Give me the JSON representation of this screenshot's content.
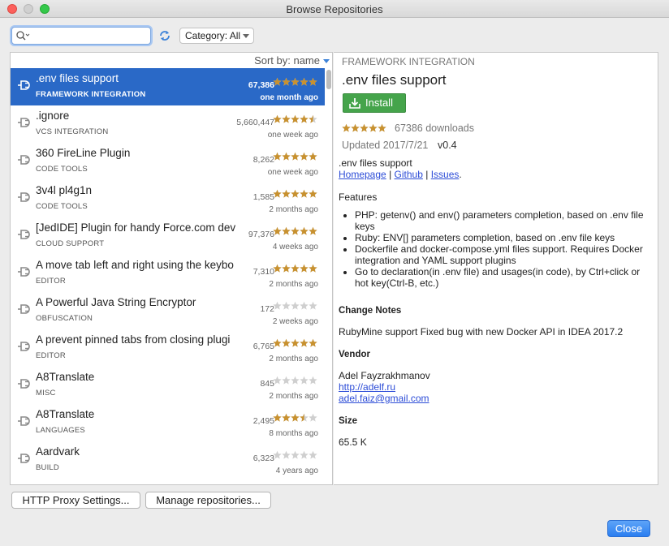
{
  "window": {
    "title": "Browse Repositories"
  },
  "toolbar": {
    "search_value": "",
    "category_label": "Category: All"
  },
  "list": {
    "sort_label": "Sort by: name",
    "items": [
      {
        "name": ".env files support",
        "category": "FRAMEWORK INTEGRATION",
        "downloads": "67,386",
        "rating": 5,
        "date": "one month ago",
        "selected": true
      },
      {
        "name": ".ignore",
        "category": "VCS INTEGRATION",
        "downloads": "5,660,447",
        "rating": 4.5,
        "date": "one week ago"
      },
      {
        "name": "360 FireLine Plugin",
        "category": "CODE TOOLS",
        "downloads": "8,262",
        "rating": 5,
        "date": "one week ago"
      },
      {
        "name": "3v4l pl4g1n",
        "category": "CODE TOOLS",
        "downloads": "1,585",
        "rating": 5,
        "date": "2 months ago"
      },
      {
        "name": "[JedIDE] Plugin for handy Force.com dev",
        "category": "CLOUD SUPPORT",
        "downloads": "97,376",
        "rating": 5,
        "date": "4 weeks ago"
      },
      {
        "name": "A move tab left and right using the keybo",
        "category": "EDITOR",
        "downloads": "7,310",
        "rating": 5,
        "date": "2 months ago"
      },
      {
        "name": "A Powerful Java String Encryptor",
        "category": "OBFUSCATION",
        "downloads": "172",
        "rating": 0,
        "date": "2 weeks ago"
      },
      {
        "name": "A prevent pinned tabs from closing plugi",
        "category": "EDITOR",
        "downloads": "6,765",
        "rating": 5,
        "date": "2 months ago"
      },
      {
        "name": "A8Translate",
        "category": "MISC",
        "downloads": "845",
        "rating": 0,
        "date": "2 months ago"
      },
      {
        "name": "A8Translate",
        "category": "LANGUAGES",
        "downloads": "2,495",
        "rating": 3.5,
        "date": "8 months ago"
      },
      {
        "name": "Aardvark",
        "category": "BUILD",
        "downloads": "6,323",
        "rating": 0,
        "date": "4 years ago"
      }
    ]
  },
  "detail": {
    "category": "FRAMEWORK INTEGRATION",
    "name": ".env files support",
    "install_label": "Install",
    "rating": 5,
    "downloads": "67386 downloads",
    "updated": "Updated 2017/7/21",
    "version": "v0.4",
    "description": ".env files support",
    "links": {
      "homepage": "Homepage",
      "github": "Github",
      "issues": "Issues",
      "sep": "|"
    },
    "features_heading": "Features",
    "features": [
      "PHP: getenv() and env() parameters completion, based on .env file keys",
      "Ruby: ENV[] parameters completion, based on .env file keys",
      "Dockerfile and docker-compose.yml files support. Requires Docker integration and YAML support plugins",
      "Go to declaration(in .env file) and usages(in code), by Ctrl+click or hot key(Ctrl-B, etc.)"
    ],
    "change_notes_heading": "Change Notes",
    "change_notes": "RubyMine support Fixed bug with new Docker API in IDEA 2017.2",
    "vendor_heading": "Vendor",
    "vendor_name": "Adel Fayzrakhmanov",
    "vendor_url": "http://adelf.ru",
    "vendor_email": "adel.faiz@gmail.com",
    "size_heading": "Size",
    "size": "65.5 K"
  },
  "footer": {
    "proxy_label": "HTTP Proxy Settings...",
    "repos_label": "Manage repositories...",
    "close_label": "Close"
  },
  "colors": {
    "selection": "#2a69c7",
    "install_green": "#45a44b",
    "star_gold": "#c8912f",
    "link": "#2c4cd7",
    "close_blue": "#2a7ef0"
  }
}
